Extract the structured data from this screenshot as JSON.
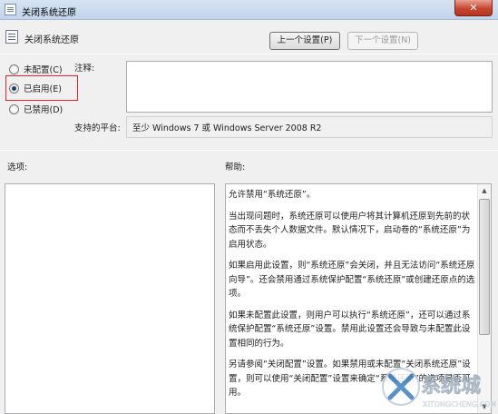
{
  "window": {
    "title": "关闭系统还原",
    "close_glyph": "✕"
  },
  "policy": {
    "name": "关闭系统还原"
  },
  "nav": {
    "prev_label": "上一个设置(P)",
    "next_label": "下一个设置(N)"
  },
  "state": {
    "options": [
      {
        "label": "未配置(C)",
        "checked": false
      },
      {
        "label": "已启用(E)",
        "checked": true
      },
      {
        "label": "已禁用(D)",
        "checked": false
      }
    ]
  },
  "comment": {
    "label": "注释:",
    "value": ""
  },
  "platform": {
    "label": "支持的平台:",
    "value": "至少 Windows 7 或 Windows Server 2008 R2"
  },
  "options_panel": {
    "label": "选项:"
  },
  "help": {
    "label": "帮助:",
    "paragraphs": [
      "允许禁用“系统还原”。",
      "当出现问题时，系统还原可以使用户将其计算机还原到先前的状态而不丢失个人数据文件。默认情况下，启动卷的“系统还原”为启用状态。",
      "如果启用此设置，则“系统还原”会关闭，并且无法访问“系统还原向导”。还会禁用通过系统保护配置“系统还原”或创建还原点的选项。",
      "如果未配置此设置，则用户可以执行“系统还原”，还可以通过系统保护配置“系统还原”设置。禁用此设置还会导致与未配置此设置相同的行为。",
      "另请参阅“关闭配置”设置。如果禁用或未配置“关闭系统还原”设置，则可以使用“关闭配置”设置来确定“系统还原”的选项是否可用。"
    ]
  },
  "watermark": {
    "text": "系统城",
    "site": "XITONGCHENG.COM"
  }
}
